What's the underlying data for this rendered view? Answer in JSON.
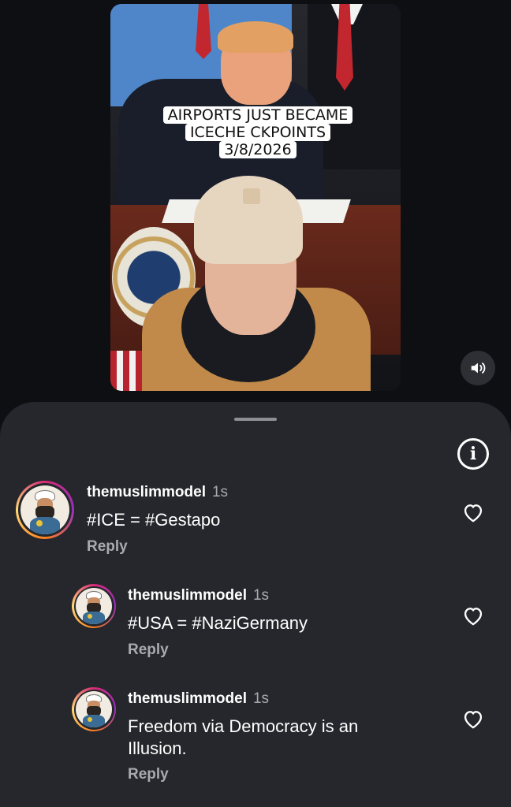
{
  "video": {
    "caption_lines": [
      "AIRPORTS JUST BECAME",
      "ICECHE CKPOINTS",
      "3/8/2026"
    ],
    "mute_icon": "speaker-volume-icon"
  },
  "sheet": {
    "info_icon": "info-icon",
    "info_label": "i"
  },
  "comments": [
    {
      "username": "themuslimmodel",
      "time": "1s",
      "text": "#ICE = #Gestapo",
      "reply_label": "Reply",
      "like_icon": "heart-outline-icon"
    },
    {
      "username": "themuslimmodel",
      "time": "1s",
      "text": "#USA = #NaziGermany",
      "reply_label": "Reply",
      "like_icon": "heart-outline-icon"
    },
    {
      "username": "themuslimmodel",
      "time": "1s",
      "text": "Freedom via Democracy is an Illusion.",
      "reply_label": "Reply",
      "like_icon": "heart-outline-icon"
    }
  ],
  "colors": {
    "background": "#0d0f13",
    "sheet": "#25272c",
    "muted_text": "#a8aab0",
    "avatar_ring_start": "#d62976",
    "avatar_ring_end": "#fa7e1e"
  }
}
